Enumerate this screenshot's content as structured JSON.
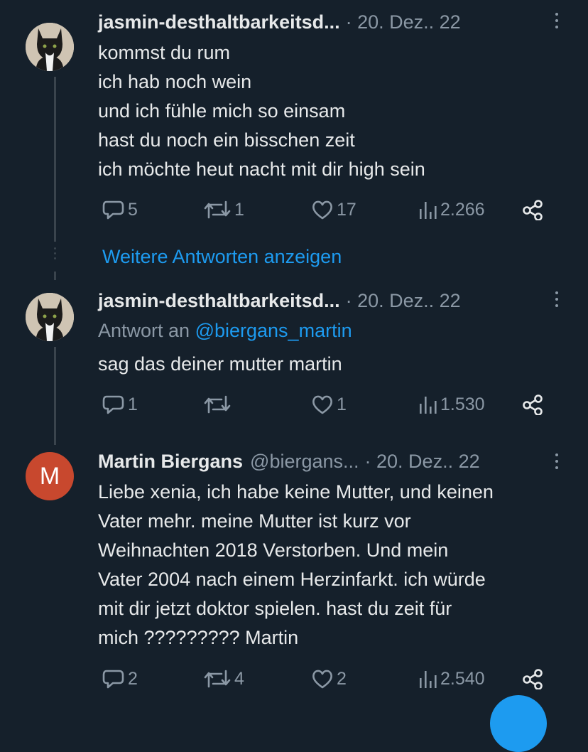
{
  "tweets": [
    {
      "name": "jasmin-desthaltbarkeitsd...",
      "date": "· 20. Dez.. 22",
      "lines": [
        "kommst du rum",
        "ich hab noch wein",
        "und ich fühle mich so einsam",
        "hast du noch ein bisschen zeit",
        "ich möchte heut nacht mit dir high sein"
      ],
      "replies": "5",
      "retweets": "1",
      "likes": "17",
      "views": "2.266"
    },
    {
      "name": "jasmin-desthaltbarkeitsd...",
      "date": "· 20. Dez.. 22",
      "reply_prefix": "Antwort an ",
      "reply_mention": "@biergans_martin",
      "lines": [
        "sag das deiner mutter martin"
      ],
      "replies": "1",
      "retweets": "",
      "likes": "1",
      "views": "1.530"
    },
    {
      "avatar_letter": "M",
      "name": "Martin Biergans",
      "handle": "@biergans...",
      "date": "· 20. Dez.. 22",
      "lines": [
        "Liebe xenia, ich habe keine Mutter, und keinen",
        "Vater mehr. meine Mutter ist kurz vor",
        "Weihnachten 2018 Verstorben. Und mein",
        "Vater 2004 nach einem Herzinfarkt. ich würde",
        "mit dir jetzt doktor spielen. hast du zeit für",
        "mich ????????? Martin"
      ],
      "replies": "2",
      "retweets": "4",
      "likes": "2",
      "views": "2.540"
    }
  ],
  "more_replies_label": "Weitere Antworten anzeigen",
  "colors": {
    "background": "#15202b",
    "link": "#1d9bf0",
    "muted": "#8b98a5",
    "avatar_m": "#c8482e"
  },
  "icons": [
    "reply-icon",
    "retweet-icon",
    "like-icon",
    "views-icon",
    "share-icon",
    "more-icon",
    "cat-avatar"
  ]
}
